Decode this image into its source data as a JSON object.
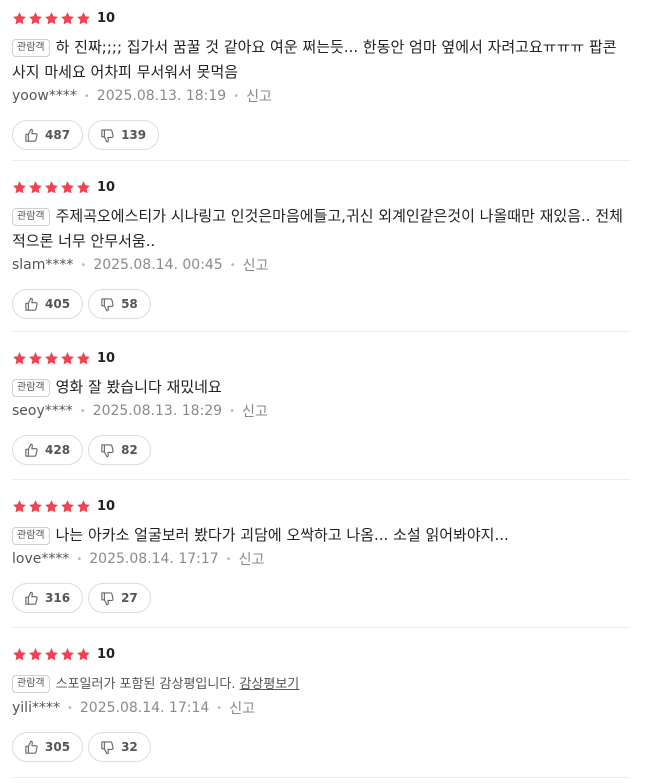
{
  "colors": {
    "star": "#f0434c"
  },
  "labels": {
    "badge": "관람객",
    "report": "신고",
    "spoiler_link": "감상평보기"
  },
  "reviews": [
    {
      "stars": 5,
      "score": "10",
      "text": "하 진짜;;;; 집가서 꿈꿀 것 같아요 여운 쩌는듯... 한동안 엄마 옆에서 자려고요ㅠㅠㅠ 팝콘 사지 마세요 어차피 무서워서 못먹음",
      "user": "yoow****",
      "date": "2025.08.13. 18:19",
      "likes": "487",
      "dislikes": "139"
    },
    {
      "stars": 5,
      "score": "10",
      "text": "주제곡오에스티가 시나링고 인것은마음에들고,귀신 외계인같은것이 나올때만 재있음.. 전체적으론 너무 안무서움..",
      "user": "slam****",
      "date": "2025.08.14. 00:45",
      "likes": "405",
      "dislikes": "58"
    },
    {
      "stars": 5,
      "score": "10",
      "text": "영화 잘 봤습니다 재밌네요",
      "user": "seoy****",
      "date": "2025.08.13. 18:29",
      "likes": "428",
      "dislikes": "82"
    },
    {
      "stars": 5,
      "score": "10",
      "text": "나는 아카소 얼굴보러 봤다가 괴담에 오싹하고 나옴... 소설 읽어봐야지...",
      "user": "love****",
      "date": "2025.08.14. 17:17",
      "likes": "316",
      "dislikes": "27"
    },
    {
      "stars": 5,
      "score": "10",
      "spoiler_text": "스포일러가 포함된 감상평입니다.",
      "user": "yili****",
      "date": "2025.08.14. 17:14",
      "likes": "305",
      "dislikes": "32"
    }
  ]
}
